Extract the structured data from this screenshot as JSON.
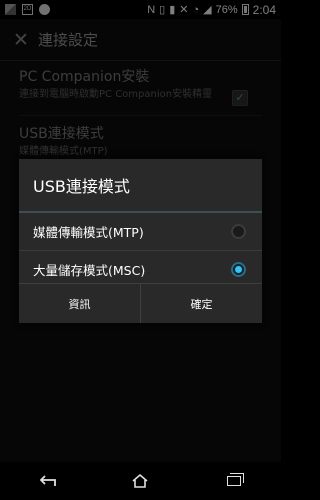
{
  "status_bar": {
    "left_icons": [
      "image-icon",
      "photo-zoom-icon",
      "sync-icon"
    ],
    "left_badge": "2D",
    "right_icons": [
      "nfc-icon",
      "sd-card-icon",
      "vibrate-icon",
      "no-sim-icon",
      "wifi-icon",
      "signal-icon",
      "battery-icon"
    ],
    "battery": "76%",
    "time": "2:04"
  },
  "action_bar": {
    "icon": "tools-icon",
    "title": "連接設定"
  },
  "settings": [
    {
      "title": "PC Companion安裝",
      "summary": "連接到電腦時啟動PC Companion安裝精靈",
      "checked": true
    },
    {
      "title": "USB連接模式",
      "summary": "媒體傳輸模式(MTP)"
    }
  ],
  "dialog": {
    "title": "USB連接模式",
    "options": [
      {
        "label": "媒體傳輸模式(MTP)",
        "selected": false
      },
      {
        "label": "大量儲存模式(MSC)",
        "selected": true
      }
    ],
    "buttons": {
      "info": "資訊",
      "ok": "確定"
    }
  },
  "nav_bar": {
    "icons": [
      "back-icon",
      "home-icon",
      "recent-apps-icon"
    ]
  },
  "colors": {
    "accent": "#38c3ef",
    "dialog_bg": "#292929"
  }
}
